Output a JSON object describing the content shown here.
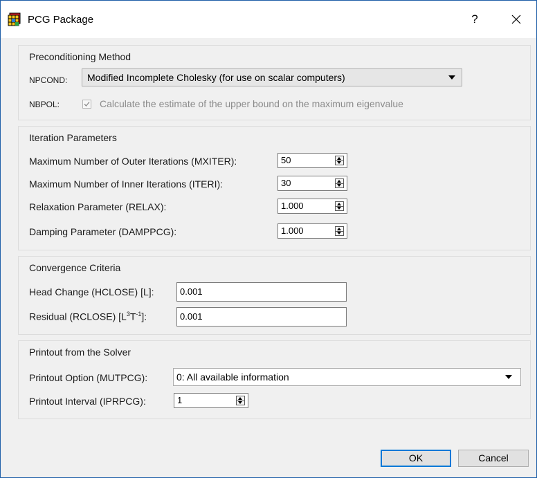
{
  "window": {
    "title": "PCG Package",
    "help_label": "?",
    "close_label": "✕"
  },
  "preconditioning": {
    "title": "Preconditioning Method",
    "npcond_label": "NPCOND:",
    "npcond_value": "Modified Incomplete Cholesky (for use on scalar computers)",
    "nbpol_label": "NBPOL:",
    "nbpol_checkbox_label": "Calculate the estimate of the upper bound on the maximum eigenvalue",
    "nbpol_checked": true
  },
  "iteration": {
    "title": "Iteration Parameters",
    "fields": [
      {
        "label": "Maximum Number of Outer Iterations (MXITER):",
        "value": "50"
      },
      {
        "label": "Maximum Number of Inner Iterations (ITERI):",
        "value": "30"
      },
      {
        "label": "Relaxation Parameter (RELAX):",
        "value": "1.000"
      },
      {
        "label": "Damping Parameter (DAMPPCG):",
        "value": "1.000"
      }
    ]
  },
  "convergence": {
    "title": "Convergence Criteria",
    "hclose_label": "Head Change (HCLOSE) [L]:",
    "hclose_value": "0.001",
    "rclose_label_prefix": "Residual (RCLOSE) [L",
    "rclose_sup1": "3",
    "rclose_mid": "T",
    "rclose_sup2": "-1",
    "rclose_label_suffix": "]:",
    "rclose_value": "0.001"
  },
  "printout": {
    "title": "Printout from the Solver",
    "option_label": "Printout Option (MUTPCG):",
    "option_value": "0: All available information",
    "interval_label": "Printout Interval (IPRPCG):",
    "interval_value": "1"
  },
  "buttons": {
    "ok": "OK",
    "cancel": "Cancel"
  }
}
